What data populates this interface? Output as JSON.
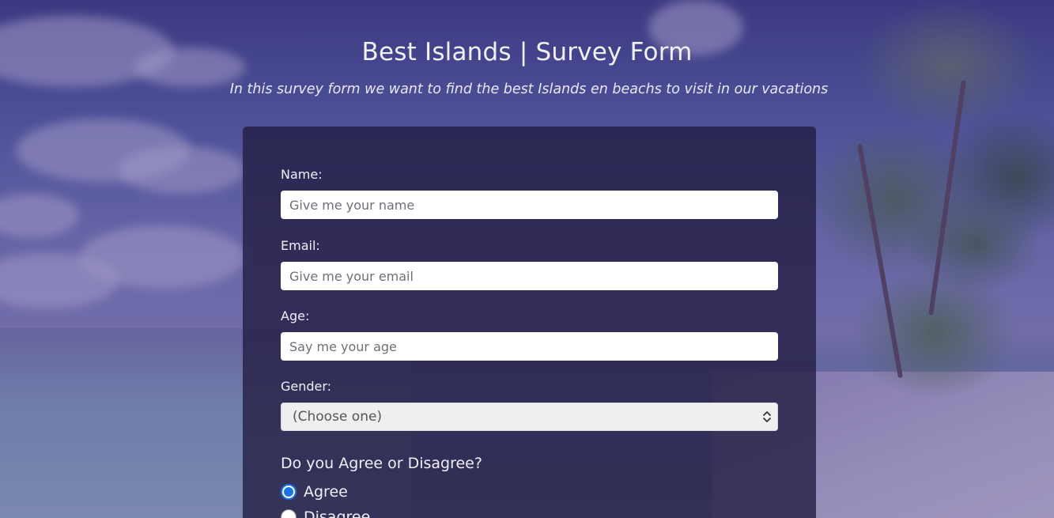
{
  "header": {
    "title": "Best Islands | Survey Form",
    "description": "In this survey form we want to find the best Islands en beachs to visit in our vacations"
  },
  "form": {
    "name": {
      "label": "Name:",
      "placeholder": "Give me your name",
      "value": ""
    },
    "email": {
      "label": "Email:",
      "placeholder": "Give me your email",
      "value": ""
    },
    "age": {
      "label": "Age:",
      "placeholder": "Say me your age",
      "value": ""
    },
    "gender": {
      "label": "Gender:",
      "selected": "(Choose one)"
    },
    "agreement": {
      "question": "Do you Agree or Disagree?",
      "options": [
        {
          "label": "Agree",
          "checked": true
        },
        {
          "label": "Disagree",
          "checked": false
        }
      ]
    }
  },
  "colors": {
    "accent": "#1a73e8",
    "form_background": "#231e44",
    "text": "#f1eff8"
  },
  "icons": {
    "select_arrow": "chevron-up-down-icon"
  }
}
